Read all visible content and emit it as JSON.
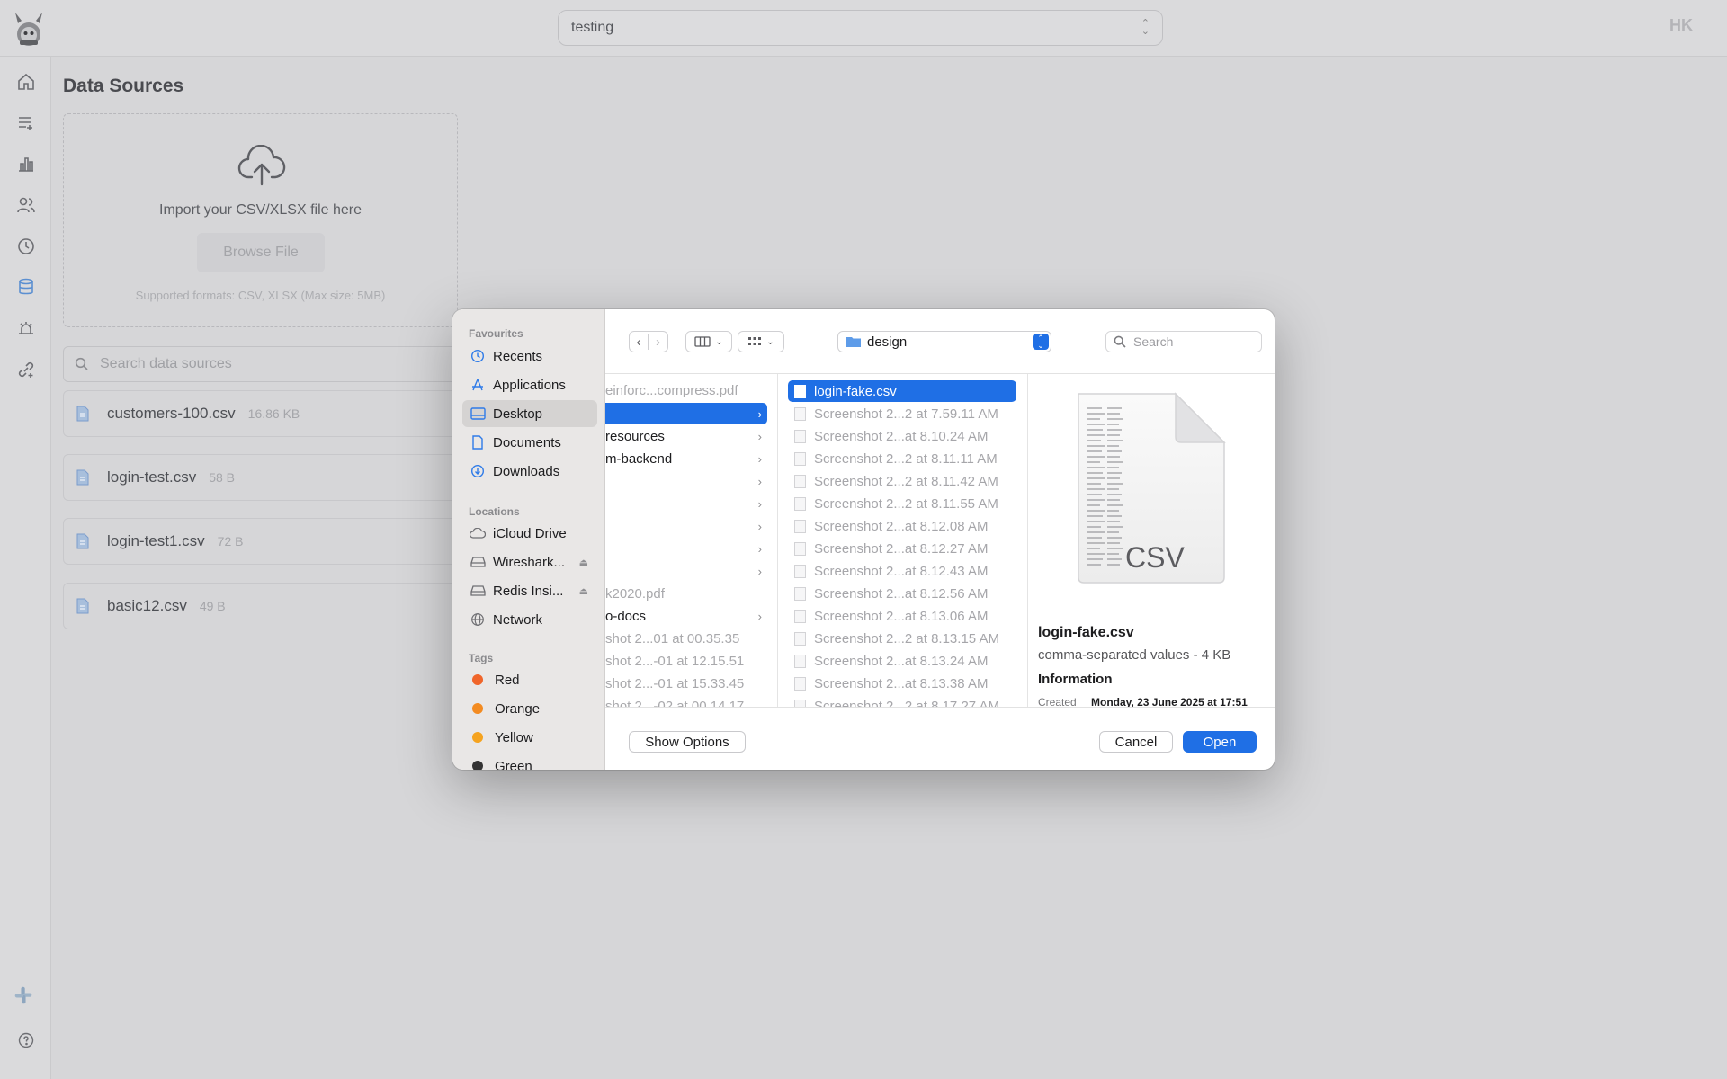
{
  "app": {
    "workspace": "testing",
    "avatar_initials": "HK",
    "page_title": "Data Sources",
    "import": {
      "text": "Import your CSV/XLSX file here",
      "browse_label": "Browse File",
      "formats": "Supported formats: CSV, XLSX (Max size: 5MB)"
    },
    "search_placeholder": "Search data sources",
    "data_sources": [
      {
        "name": "customers-100.csv",
        "size": "16.86 KB"
      },
      {
        "name": "login-test.csv",
        "size": "58 B"
      },
      {
        "name": "login-test1.csv",
        "size": "72 B"
      },
      {
        "name": "basic12.csv",
        "size": "49 B"
      }
    ],
    "sidebar_icons": [
      "home-icon",
      "list-add-icon",
      "bar-chart-icon",
      "users-icon",
      "clock-icon",
      "database-icon",
      "bug-icon",
      "link-plus-icon",
      "slack-icon",
      "help-icon"
    ]
  },
  "dialog": {
    "sidebar": {
      "favourites_title": "Favourites",
      "favourites": [
        "Recents",
        "Applications",
        "Desktop",
        "Documents",
        "Downloads"
      ],
      "selected": "Desktop",
      "locations_title": "Locations",
      "locations": [
        "iCloud Drive",
        "Wireshark...",
        "Redis Insi...",
        "Network"
      ],
      "tags_title": "Tags",
      "tags": [
        {
          "name": "Red",
          "color": "#f0652a"
        },
        {
          "name": "Orange",
          "color": "#f38b21"
        },
        {
          "name": "Yellow",
          "color": "#f5a31f"
        },
        {
          "name": "Green",
          "color": "#333333"
        }
      ]
    },
    "folder": "design",
    "search_placeholder": "Search",
    "column1": [
      {
        "label": "einforc...compress.pdf",
        "dim": true
      },
      {
        "label": "",
        "selected": true,
        "arrow": true
      },
      {
        "label": " resources",
        "arrow": true
      },
      {
        "label": "m-backend",
        "arrow": true
      },
      {
        "label": "",
        "arrow": true
      },
      {
        "label": "",
        "arrow": true
      },
      {
        "label": "",
        "arrow": true
      },
      {
        "label": "",
        "arrow": true
      },
      {
        "label": "",
        "arrow": true
      },
      {
        "label": "k2020.pdf",
        "dim": true
      },
      {
        "label": "o-docs",
        "arrow": true
      },
      {
        "label": "shot 2...01 at 00.35.35",
        "dim": true
      },
      {
        "label": "shot 2...-01 at 12.15.51",
        "dim": true
      },
      {
        "label": "shot 2...-01 at 15.33.45",
        "dim": true
      },
      {
        "label": "shot 2...-02 at 00.14.17",
        "dim": true
      }
    ],
    "column2": [
      "login-fake.csv",
      "Screenshot 2...2 at 7.59.11 AM",
      "Screenshot 2...at 8.10.24 AM",
      "Screenshot 2...2 at 8.11.11 AM",
      "Screenshot 2...2 at 8.11.42 AM",
      "Screenshot 2...2 at 8.11.55 AM",
      "Screenshot 2...at 8.12.08 AM",
      "Screenshot 2...at 8.12.27 AM",
      "Screenshot 2...at 8.12.43 AM",
      "Screenshot 2...at 8.12.56 AM",
      "Screenshot 2...at 8.13.06 AM",
      "Screenshot 2...2 at 8.13.15 AM",
      "Screenshot 2...at 8.13.24 AM",
      "Screenshot 2...at 8.13.38 AM",
      "Screenshot 2...2 at 8.17.27 AM"
    ],
    "preview": {
      "icon_label": "CSV",
      "name": "login-fake.csv",
      "kind": "comma-separated values - 4 KB",
      "info_title": "Information",
      "created_label": "Created",
      "created_value": "Monday, 23 June 2025 at 17:51"
    },
    "show_options": "Show Options",
    "cancel": "Cancel",
    "open": "Open"
  }
}
